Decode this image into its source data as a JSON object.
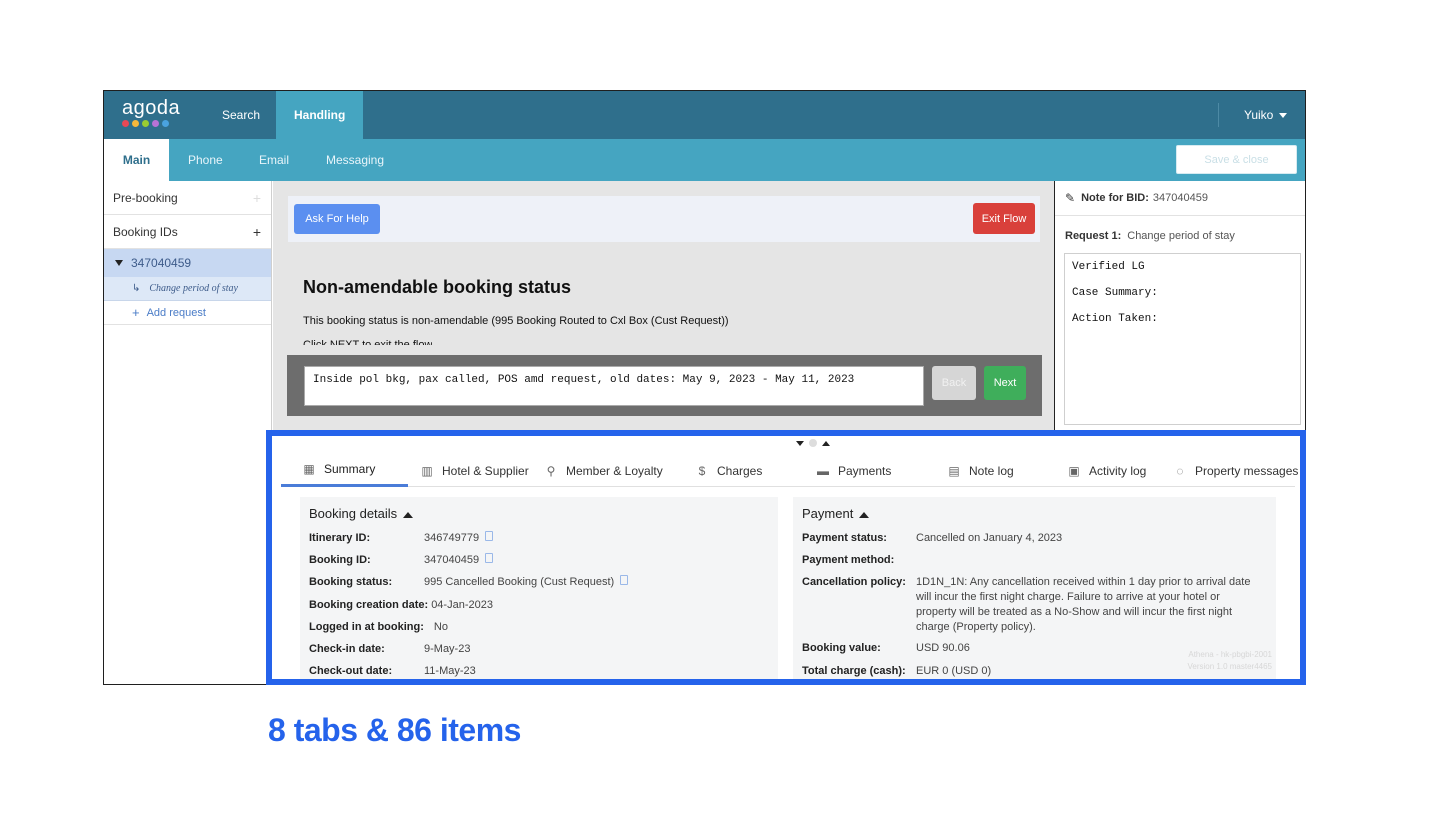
{
  "app": {
    "logo": "agoda",
    "logo_colors": [
      "#e84855",
      "#f6b93b",
      "#9acd32",
      "#b872d6",
      "#4aa3df"
    ],
    "nav": {
      "search": "Search",
      "handling": "Handling"
    },
    "user": "Yuiko",
    "subtabs": {
      "main": "Main",
      "phone": "Phone",
      "email": "Email",
      "messaging": "Messaging"
    },
    "save_close": "Save & close"
  },
  "sidebar": {
    "prebooking": "Pre-booking",
    "booking_ids": "Booking IDs",
    "booking_id": "347040459",
    "request": "Change period of stay",
    "add_request": "Add request",
    "plus": "+"
  },
  "flow": {
    "ask_help": "Ask For Help",
    "exit": "Exit Flow",
    "title": "Non-amendable booking status",
    "description": "This booking status is non-amendable (995 Booking Routed to Cxl Box (Cust Request))",
    "cut_text": "Click NEXT to exit the flow",
    "note_text": "Inside pol bkg, pax called, POS amd request, old dates: May 9, 2023 - May 11, 2023",
    "back": "Back",
    "next": "Next"
  },
  "note_panel": {
    "label": "Note for BID:",
    "bid": "347040459",
    "request_label": "Request 1:",
    "request_value": "Change period of stay",
    "lines": [
      "Verified LG",
      "Case Summary:",
      "Action Taken:"
    ]
  },
  "details": {
    "tabs": [
      {
        "label": "Summary",
        "icon": "calendar-icon"
      },
      {
        "label": "Hotel & Supplier",
        "icon": "building-icon"
      },
      {
        "label": "Member & Loyalty",
        "icon": "person-icon"
      },
      {
        "label": "Charges",
        "icon": "dollar-icon"
      },
      {
        "label": "Payments",
        "icon": "card-icon"
      },
      {
        "label": "Note log",
        "icon": "note-icon"
      },
      {
        "label": "Activity log",
        "icon": "activity-icon"
      },
      {
        "label": "Property messages",
        "icon": "chat-icon"
      }
    ],
    "booking": {
      "title": "Booking details",
      "rows": [
        {
          "k": "Itinerary ID:",
          "v": "346749779"
        },
        {
          "k": "Booking ID:",
          "v": "347040459"
        },
        {
          "k": "Booking status:",
          "v": "995 Cancelled Booking (Cust Request)"
        },
        {
          "k": "Booking creation date:",
          "v": "04-Jan-2023"
        },
        {
          "k": "Logged in at booking:",
          "v": "No"
        },
        {
          "k": "Check-in date:",
          "v": "9-May-23"
        },
        {
          "k": "Check-out date:",
          "v": "11-May-23"
        }
      ]
    },
    "payment": {
      "title": "Payment",
      "rows": [
        {
          "k": "Payment status:",
          "v": "Cancelled on January 4, 2023"
        },
        {
          "k": "Payment method:",
          "v": ""
        },
        {
          "k": "Cancellation policy:",
          "v": "1D1N_1N: Any cancellation received within 1 day prior to arrival date will incur the first night charge. Failure to arrive at your hotel or property will be treated as a No-Show and will incur the first night charge (Property policy)."
        },
        {
          "k": "Booking value:",
          "v": "USD 90.06"
        },
        {
          "k": "Total charge (cash):",
          "v": "EUR 0 (USD 0)"
        }
      ],
      "version_lines": [
        "Athena - hk-pbgbi-2001",
        "Version 1.0 master4465"
      ]
    }
  },
  "caption": "8 tabs & 86 items"
}
